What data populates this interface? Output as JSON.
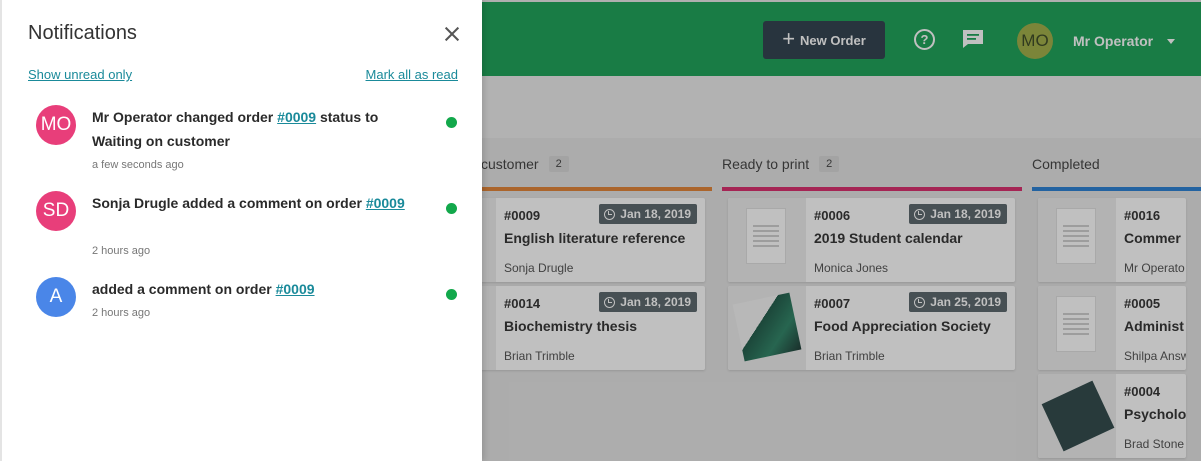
{
  "header": {
    "new_order_label": "New Order",
    "help_glyph": "?",
    "user_initials": "MO",
    "user_name": "Mr Operator",
    "color": "#0a9b4b"
  },
  "columns": [
    {
      "name": "customer",
      "count": "2",
      "bar_color": "#e07a26",
      "cards": [
        {
          "number": "#0009",
          "date": "Jan 18, 2019",
          "title": "English literature reference",
          "person": "Sonja Drugle",
          "thumb": "document"
        },
        {
          "number": "#0014",
          "date": "Jan 18, 2019",
          "title": "Biochemistry thesis",
          "person": "Brian Trimble",
          "thumb": "document"
        }
      ]
    },
    {
      "name": "Ready to print",
      "count": "2",
      "bar_color": "#d81b60",
      "cards": [
        {
          "number": "#0006",
          "date": "Jan 18, 2019",
          "title": "2019 Student calendar",
          "person": "Monica Jones",
          "thumb": "document"
        },
        {
          "number": "#0007",
          "date": "Jan 25, 2019",
          "title": "Food Appreciation Society",
          "person": "Brian Trimble",
          "thumb": "poster"
        }
      ]
    },
    {
      "name": "Completed",
      "count": "",
      "bar_color": "#1976d2",
      "cards": [
        {
          "number": "#0016",
          "date": "",
          "title": "Commer",
          "person": "Mr Operato",
          "thumb": "document"
        },
        {
          "number": "#0005",
          "date": "",
          "title": "Administ",
          "person": "Shilpa Answ",
          "thumb": "document"
        },
        {
          "number": "#0004",
          "date": "",
          "title": "Psycholo",
          "person": "Brad Stone",
          "thumb": "book"
        }
      ]
    }
  ],
  "panel": {
    "title": "Notifications",
    "show_unread_label": "Show unread only",
    "mark_all_label": "Mark all as read",
    "items": [
      {
        "initials": "MO",
        "avatar_color": "#e83e7a",
        "text_before": "Mr Operator changed order ",
        "order_link": "#0009",
        "text_after": " status to Waiting on customer",
        "time": "a few seconds ago",
        "unread": true
      },
      {
        "initials": "SD",
        "avatar_color": "#e83e7a",
        "text_before": "Sonja Drugle added a comment on order ",
        "order_link": "#0009",
        "text_after": "",
        "time": "2 hours ago",
        "unread": true
      },
      {
        "initials": "A",
        "avatar_color": "#4a86e8",
        "text_before": "added a comment on order ",
        "order_link": "#0009",
        "text_after": "",
        "time": "2 hours ago",
        "unread": true
      }
    ]
  }
}
